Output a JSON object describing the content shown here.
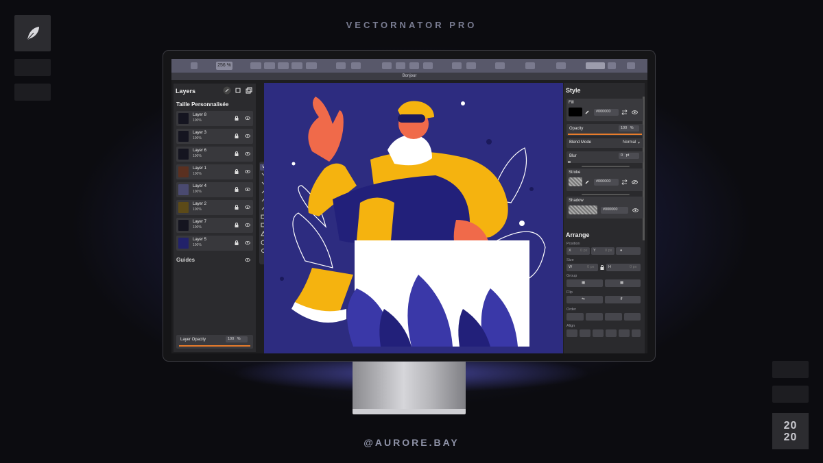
{
  "header_title": "VECTORNATOR PRO",
  "handle": "@AURORE.BAY",
  "year_line1": "20",
  "year_line2": "20",
  "toolbar": {
    "zoom": "256 %"
  },
  "document_tab": "Bonjour",
  "layers_panel": {
    "title": "Layers",
    "artboard": "Taille Personnalisée",
    "layers": [
      {
        "name": "Layer 8",
        "opacity": "100%"
      },
      {
        "name": "Layer 3",
        "opacity": "100%"
      },
      {
        "name": "Layer 6",
        "opacity": "100%"
      },
      {
        "name": "Layer 1",
        "opacity": "100%"
      },
      {
        "name": "Layer 4",
        "opacity": "100%"
      },
      {
        "name": "Layer 2",
        "opacity": "100%"
      },
      {
        "name": "Layer 7",
        "opacity": "100%"
      },
      {
        "name": "Layer 5",
        "opacity": "100%"
      }
    ],
    "guides": "Guides",
    "layer_opacity_label": "Layer Opacity",
    "layer_opacity_value": "100",
    "layer_opacity_unit": "%",
    "layer_opacity_fraction": 1.0
  },
  "style_panel": {
    "title": "Style",
    "fill_label": "Fill",
    "fill_hex": "#000000",
    "opacity_label": "Opacity",
    "opacity_value": "100",
    "opacity_unit": "%",
    "blend_mode_label": "Blend Mode",
    "blend_mode_value": "Normal",
    "blur_label": "Blur",
    "blur_value": "0",
    "blur_unit": "pt",
    "stroke_label": "Stroke",
    "stroke_hex": "#000000",
    "shadow_label": "Shadow",
    "shadow_hex": "#000000"
  },
  "arrange_panel": {
    "title": "Arrange",
    "position_label": "Position",
    "x_label": "X",
    "x_value": "0 px",
    "y_label": "Y",
    "y_value": "0 px",
    "size_label": "Size",
    "w_label": "W",
    "w_value": "0 px",
    "h_label": "H",
    "h_value": "0 px",
    "group_label": "Group",
    "flip_label": "Flip",
    "order_label": "Order",
    "align_label": "Align"
  },
  "colors": {
    "canvas_bg": "#2d2c80",
    "accent_orange": "#e87c2b",
    "character_yellow": "#f5b30f",
    "skin": "#f06a4a"
  }
}
